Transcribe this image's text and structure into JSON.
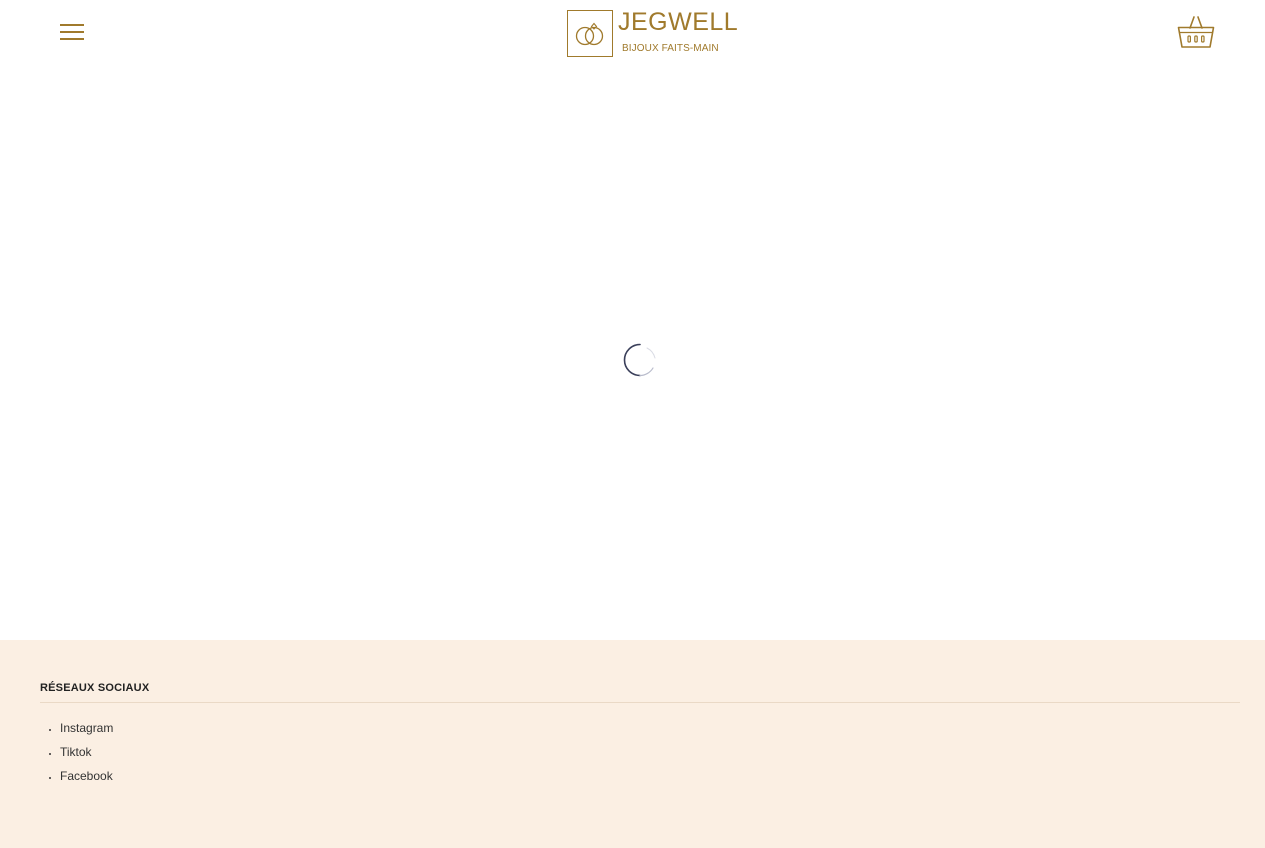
{
  "header": {
    "brand_name": "JEGWELL",
    "brand_tagline": "BIJOUX FAITS-MAIN",
    "menu_icon": "hamburger-menu-icon",
    "logo_icon": "rings-icon",
    "cart_icon": "basket-icon"
  },
  "main": {
    "loading_icon": "spinner-icon"
  },
  "footer": {
    "heading": "RÉSEAUX SOCIAUX",
    "social_links": [
      {
        "label": "Instagram"
      },
      {
        "label": "Tiktok"
      },
      {
        "label": "Facebook"
      }
    ]
  },
  "colors": {
    "accent": "#a07a2c",
    "footer_bg": "#fbefe3"
  }
}
